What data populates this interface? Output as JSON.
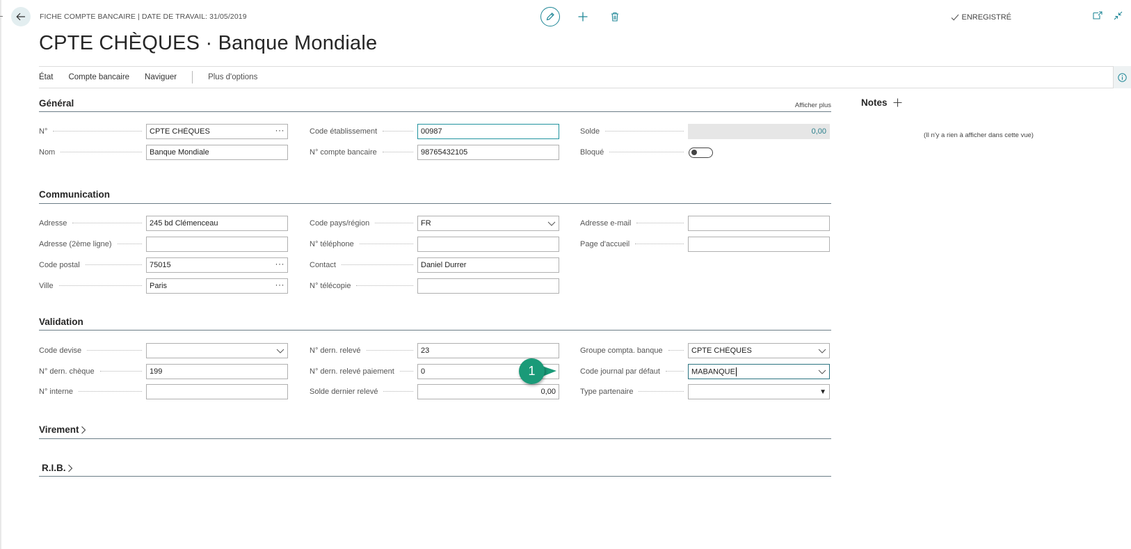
{
  "header": {
    "breadcrumb": "FICHE COMPTE BANCAIRE | DATE DE TRAVAIL: 31/05/2019",
    "title": "CPTE CHÈQUES · Banque Mondiale",
    "saved_status": "ENREGISTRÉ"
  },
  "action_bar": {
    "items": [
      "État",
      "Compte bancaire",
      "Naviguer"
    ],
    "more": "Plus d'options"
  },
  "sections": {
    "general": {
      "title": "Général",
      "show_more": "Afficher plus",
      "fields": {
        "no": {
          "label": "N°",
          "value": "CPTE CHÈQUES"
        },
        "name": {
          "label": "Nom",
          "value": "Banque Mondiale"
        },
        "bank_code": {
          "label": "Code établissement",
          "value": "00987"
        },
        "bank_account_no": {
          "label": "N° compte bancaire",
          "value": "98765432105"
        },
        "balance": {
          "label": "Solde",
          "value": "0,00"
        },
        "blocked": {
          "label": "Bloqué",
          "value": false
        }
      }
    },
    "communication": {
      "title": "Communication",
      "fields": {
        "address": {
          "label": "Adresse",
          "value": "245 bd Clémenceau"
        },
        "address2": {
          "label": "Adresse (2ème ligne)",
          "value": ""
        },
        "post_code": {
          "label": "Code postal",
          "value": "75015"
        },
        "city": {
          "label": "Ville",
          "value": "Paris"
        },
        "country": {
          "label": "Code pays/région",
          "value": "FR"
        },
        "phone": {
          "label": "N° téléphone",
          "value": ""
        },
        "contact": {
          "label": "Contact",
          "value": "Daniel Durrer"
        },
        "fax": {
          "label": "N° télécopie",
          "value": ""
        },
        "email": {
          "label": "Adresse e-mail",
          "value": ""
        },
        "home_page": {
          "label": "Page d'accueil",
          "value": ""
        }
      }
    },
    "validation": {
      "title": "Validation",
      "fields": {
        "currency": {
          "label": "Code devise",
          "value": ""
        },
        "last_check_no": {
          "label": "N° dern. chèque",
          "value": "199"
        },
        "internal_no": {
          "label": "N° interne",
          "value": ""
        },
        "last_statement_no": {
          "label": "N° dern. relevé",
          "value": "23"
        },
        "last_payment_statement_no": {
          "label": "N° dern. relevé paiement",
          "value": "0"
        },
        "last_statement_balance": {
          "label": "Solde dernier relevé",
          "value": "0,00"
        },
        "posting_group": {
          "label": "Groupe compta. banque",
          "value": "CPTE CHÈQUES"
        },
        "default_journal": {
          "label": "Code journal par défaut",
          "value": "MABANQUE"
        },
        "partner_type": {
          "label": "Type partenaire",
          "value": ""
        }
      }
    },
    "transfer": {
      "title": "Virement"
    },
    "rib": {
      "title": "R.I.B."
    }
  },
  "notes": {
    "title": "Notes",
    "empty_text": "(Il n'y a rien à afficher dans cette vue)"
  },
  "callout": {
    "number": "1",
    "color": "#1a9a78"
  },
  "colors": {
    "accent": "#1f8797",
    "section_line": "#6b7d87"
  },
  "icons": [
    "back-arrow-icon",
    "pencil-icon",
    "plus-icon",
    "trash-icon",
    "checkmark-icon",
    "open-new-window-icon",
    "collapse-icon",
    "info-icon",
    "chevron-right-icon",
    "chevron-down-icon",
    "ellipsis-icon"
  ]
}
